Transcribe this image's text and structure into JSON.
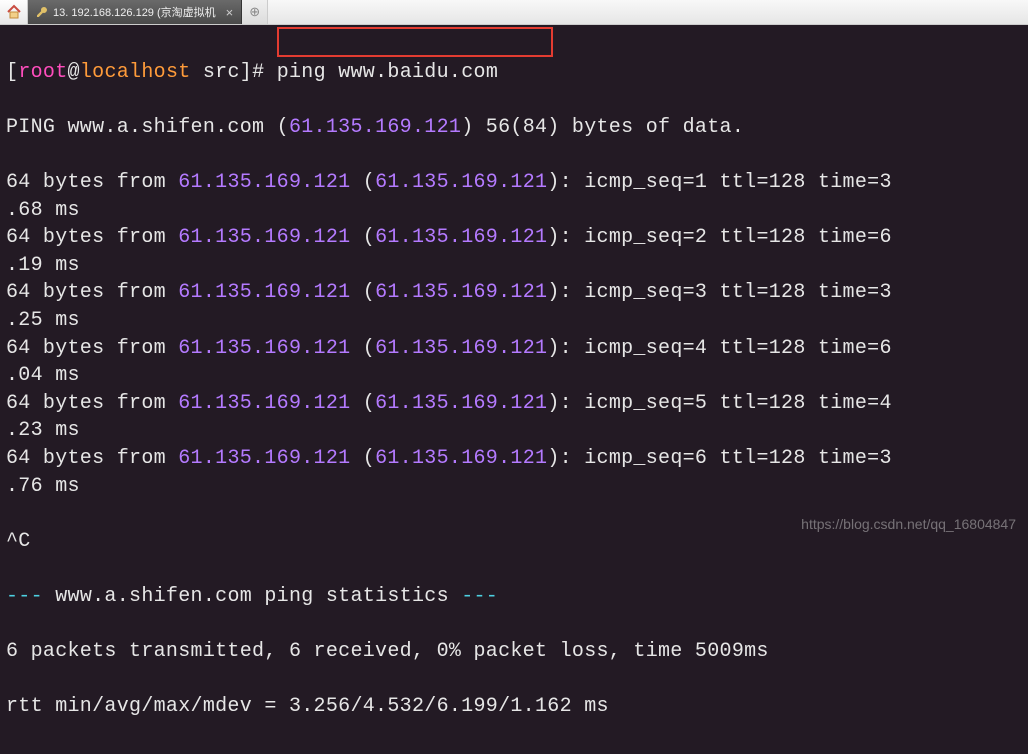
{
  "tabbar": {
    "tab1_label": "13. 192.168.126.129 (京淘虚拟机",
    "newtab_glyph": "⊕"
  },
  "prompt": {
    "open": "[",
    "user": "root",
    "at": "@",
    "host": "localhost",
    "path": " src",
    "close": "]# ",
    "command": "ping www.baidu.com"
  },
  "ping_header": {
    "prefix": "PING www.a.shifen.com (",
    "ip": "61.135.169.121",
    "suffix": ") 56(84) bytes of data."
  },
  "replies": [
    {
      "seq": "1",
      "time": "3.68"
    },
    {
      "seq": "2",
      "time": "6.19"
    },
    {
      "seq": "3",
      "time": "3.25"
    },
    {
      "seq": "4",
      "time": "6.04"
    },
    {
      "seq": "5",
      "time": "4.23"
    },
    {
      "seq": "6",
      "time": "3.76"
    }
  ],
  "reply_tpl": {
    "p1": "64 bytes from ",
    "ip": "61.135.169.121",
    "p2": " (",
    "p3": "): icmp_seq=",
    "p4": " ttl=128 time=",
    "cont_prefix": ".",
    "cont_suffix": " ms"
  },
  "interrupt": "^C",
  "stats_header": {
    "dashes": "--- ",
    "text": "www.a.shifen.com ping statistics",
    "dashes_end": " ---"
  },
  "stats_line": "6 packets transmitted, 6 received, 0% packet loss, time 5009ms",
  "rtt_line": "rtt min/avg/max/mdev = 3.256/4.532/6.199/1.162 ms",
  "watermark": "https://blog.csdn.net/qq_16804847"
}
